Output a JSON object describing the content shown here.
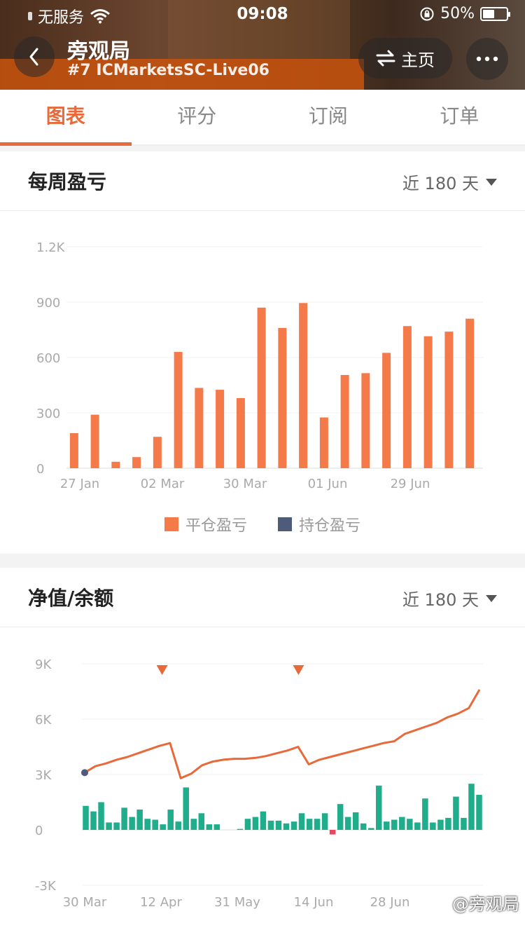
{
  "status_bar": {
    "carrier": "无服务",
    "time": "09:08",
    "battery": "50%",
    "battery_level": 0.5
  },
  "header": {
    "title": "旁观局",
    "subtitle": "#7 ICMarketsSC-Live06",
    "home_label": "主页"
  },
  "tabs": [
    {
      "label": "图表",
      "active": true
    },
    {
      "label": "评分",
      "active": false
    },
    {
      "label": "订阅",
      "active": false
    },
    {
      "label": "订单",
      "active": false
    }
  ],
  "colors": {
    "accent": "#e8693a",
    "bar_closed": "#f47a49",
    "bar_open": "#4f5b7a",
    "positive": "#1fad8b",
    "negative": "#e8475f",
    "line": "#e8693a"
  },
  "weekly_pnl": {
    "title": "每周盈亏",
    "range_label": "近 180 天",
    "legend": {
      "closed": "平仓盈亏",
      "open": "持仓盈亏"
    }
  },
  "equity": {
    "title": "净值/余额",
    "range_label": "近 180 天"
  },
  "watermark": "@旁观局",
  "chart_data": [
    {
      "type": "bar",
      "y_ticks": [
        "0",
        "300",
        "600",
        "900",
        "1.2K"
      ],
      "x_ticks": [
        "27 Jan",
        "02 Mar",
        "30 Mar",
        "01 Jun",
        "29 Jun"
      ],
      "ylim": [
        0,
        1200
      ],
      "grid": true,
      "legend_position": "bottom",
      "series": [
        {
          "name": "平仓盈亏",
          "values": [
            190,
            290,
            35,
            60,
            170,
            630,
            435,
            425,
            380,
            870,
            760,
            895,
            275,
            505,
            515,
            625,
            770,
            715,
            740,
            810
          ]
        }
      ]
    },
    {
      "type": "line",
      "y_ticks": [
        "-3K",
        "0",
        "3K",
        "6K",
        "9K"
      ],
      "x_ticks": [
        "30 Mar",
        "12 Apr",
        "31 May",
        "14 Jun",
        "28 Jun",
        ""
      ],
      "ylim": [
        -3000,
        9000
      ],
      "grid": true,
      "markers": [
        0.2,
        0.54
      ],
      "series": [
        {
          "name": "",
          "type": "line",
          "values": [
            3100,
            3450,
            3600,
            3800,
            3950,
            4150,
            4350,
            4550,
            4700,
            2800,
            3050,
            3500,
            3700,
            3800,
            3850,
            3850,
            3900,
            4000,
            4150,
            4300,
            4500,
            3550,
            3800,
            3950,
            4100,
            4250,
            4400,
            4550,
            4700,
            4800,
            5200,
            5400,
            5600,
            5800,
            6100,
            6300,
            6600,
            7600
          ]
        },
        {
          "name": "",
          "type": "bar",
          "values": [
            1300,
            1000,
            1500,
            400,
            400,
            1200,
            700,
            1100,
            600,
            550,
            300,
            1100,
            450,
            2300,
            600,
            900,
            300,
            300,
            0,
            0,
            50,
            600,
            700,
            1000,
            500,
            500,
            350,
            450,
            900,
            600,
            600,
            900,
            -250,
            1400,
            700,
            950,
            350,
            100,
            2400,
            450,
            550,
            700,
            600,
            400,
            1700,
            400,
            550,
            650,
            1800,
            650,
            2500,
            1900
          ]
        }
      ]
    }
  ]
}
